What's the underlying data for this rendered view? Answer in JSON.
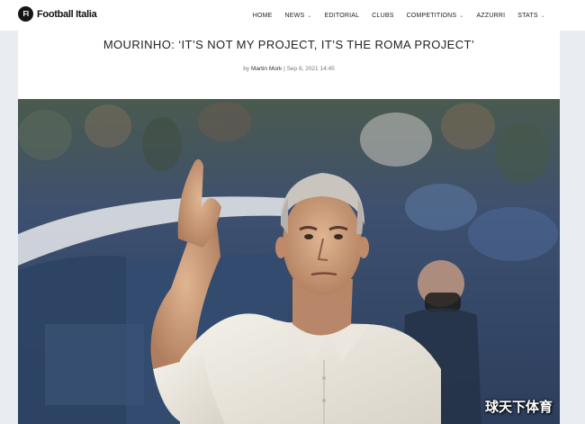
{
  "site": {
    "logo_mark": "FI",
    "logo_text": "Football Italia"
  },
  "nav": {
    "items": [
      {
        "label": "HOME",
        "dropdown": false
      },
      {
        "label": "NEWS",
        "dropdown": true
      },
      {
        "label": "EDITORIAL",
        "dropdown": false
      },
      {
        "label": "CLUBS",
        "dropdown": false
      },
      {
        "label": "COMPETITIONS",
        "dropdown": true
      },
      {
        "label": "AZZURRI",
        "dropdown": false
      },
      {
        "label": "STATS",
        "dropdown": true
      }
    ]
  },
  "article": {
    "headline": "MOURINHO: ‘IT’S NOT MY PROJECT, IT’S THE ROMA PROJECT’",
    "byline_prefix": "by",
    "author": "Martin Mork",
    "separator": "|",
    "date": "Sep 8, 2021 14:45"
  },
  "watermark": "球天下体育",
  "colors": {
    "background": "#e9ecf1",
    "header_bg": "#ffffff",
    "text": "#222222"
  }
}
